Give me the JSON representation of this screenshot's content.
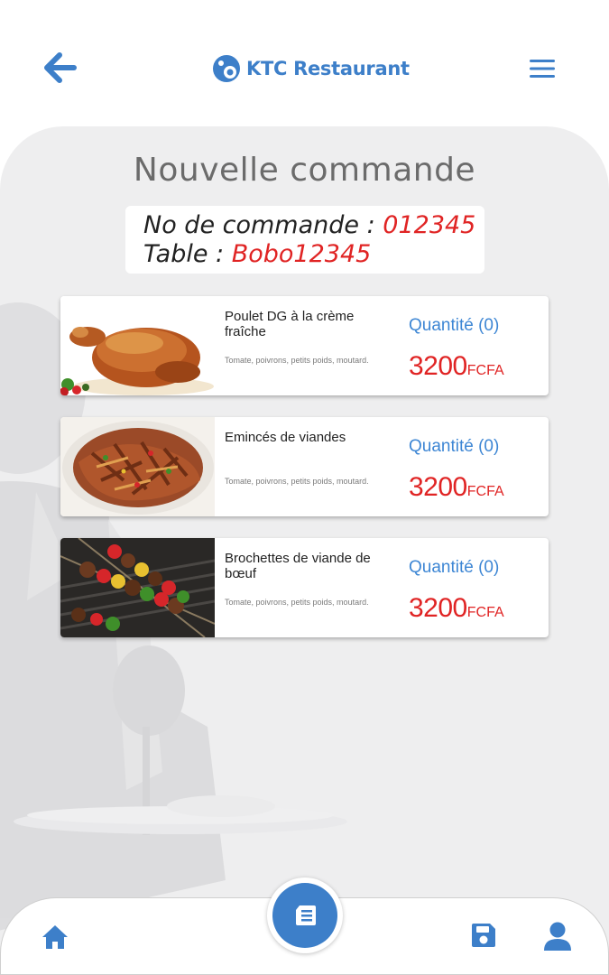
{
  "header": {
    "title": "KTC Restaurant",
    "back_icon": "arrow-left-icon",
    "logo_icon": "restaurant-logo-icon",
    "menu_icon": "hamburger-menu-icon"
  },
  "page": {
    "title": "Nouvelle commande"
  },
  "order": {
    "number_label": "No de commande : ",
    "number_value": "012345",
    "table_label": "Table : ",
    "table_value": "Bobo12345"
  },
  "dishes": [
    {
      "name": "Poulet DG à la crème fraîche",
      "description": "Tomate, poivrons, petits poids, moutard.",
      "quantity_label": "Quantité (0)",
      "price": "3200",
      "currency": "FCFA",
      "image": "roast-chicken-photo"
    },
    {
      "name": "Emincés de viandes",
      "description": "Tomate, poivrons, petits poids, moutard.",
      "quantity_label": "Quantité (0)",
      "price": "3200",
      "currency": "FCFA",
      "image": "sliced-meat-stir-fry-photo"
    },
    {
      "name": "Brochettes de viande de bœuf",
      "description": "Tomate, poivrons, petits poids, moutard.",
      "quantity_label": "Quantité (0)",
      "price": "3200",
      "currency": "FCFA",
      "image": "beef-skewers-photo"
    }
  ],
  "bottom_nav": {
    "home_icon": "home-icon",
    "center_icon": "order-list-icon",
    "save_icon": "save-icon",
    "profile_icon": "user-icon"
  },
  "colors": {
    "primary_blue": "#3d7fc9",
    "quantity_blue": "#3d86d4",
    "price_red": "#e02424",
    "panel_bg": "#eeeeef",
    "title_gray": "#6b6b6b"
  }
}
